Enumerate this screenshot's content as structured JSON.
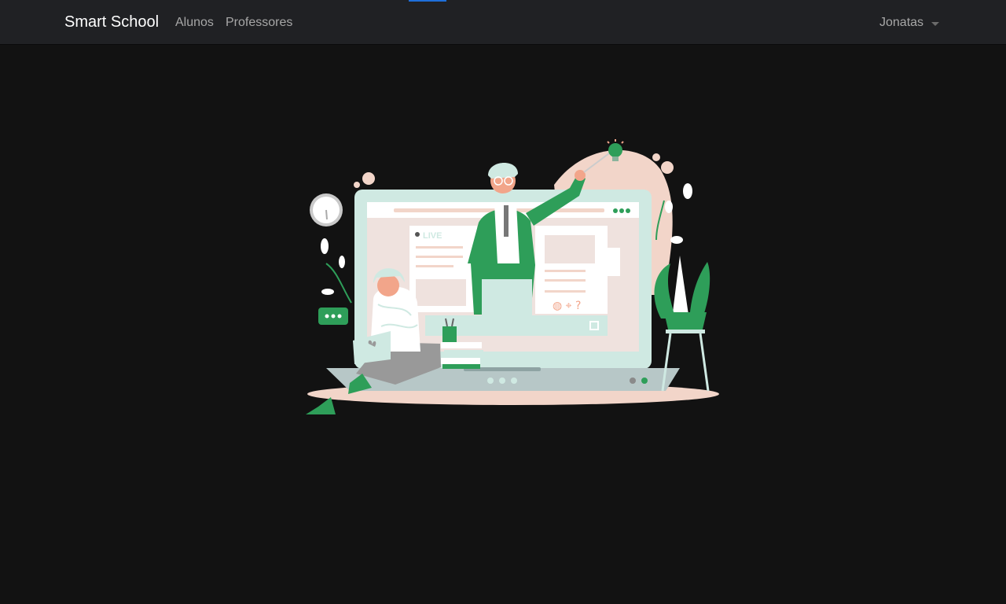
{
  "navbar": {
    "brand": "Smart School",
    "links": [
      {
        "label": "Alunos"
      },
      {
        "label": "Professores"
      }
    ],
    "user": {
      "name": "Jonatas",
      "icon": "caret-down-icon"
    }
  },
  "hero": {
    "illustration": "online-teaching-illustration",
    "live_label": "LIVE",
    "colors": {
      "green": "#2e9e59",
      "mint": "#cfe9e2",
      "peach": "#f2d5c9",
      "skin": "#f2a58a"
    }
  }
}
